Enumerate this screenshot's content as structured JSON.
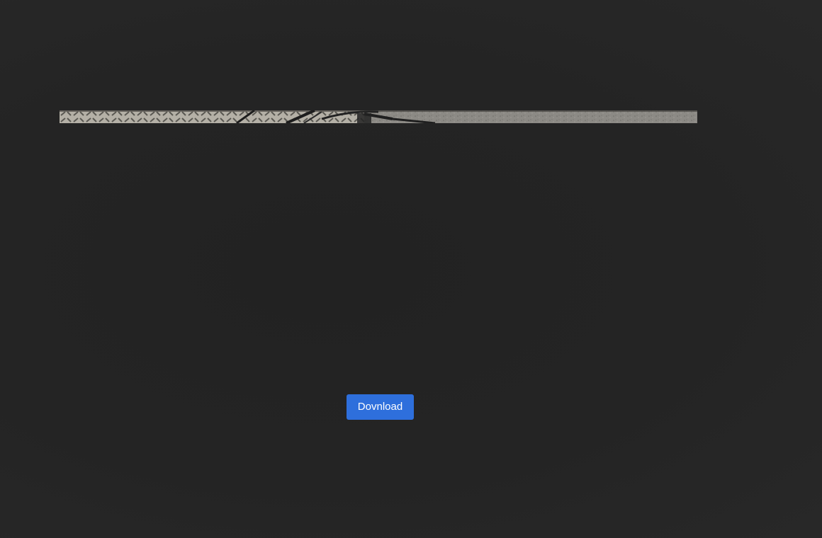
{
  "preview": {
    "image_description_icon": "photo-preview-icon"
  },
  "actions": {
    "download_label": "Dovnload"
  },
  "colors": {
    "background": "#242424",
    "button": "#2e6fdc",
    "button_text": "#ffffff"
  }
}
